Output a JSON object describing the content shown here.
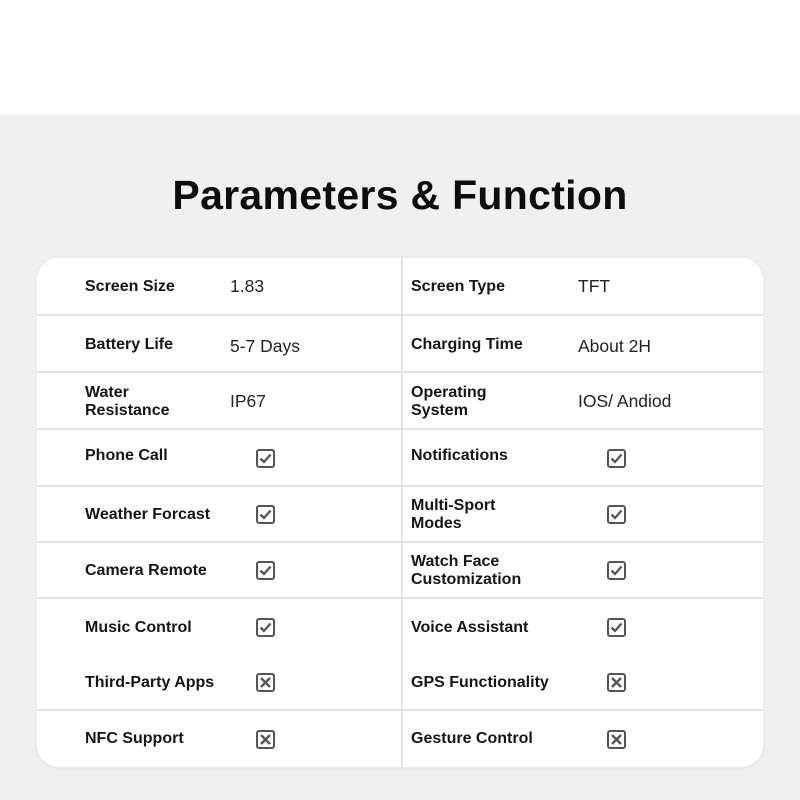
{
  "title": "Parameters & Function",
  "specs": [
    {
      "left": {
        "label": "Screen Size",
        "value": "1.83"
      },
      "right": {
        "label": "Screen Type",
        "value": "TFT"
      }
    },
    {
      "left": {
        "label": "Battery Life",
        "value": "5-7 Days"
      },
      "right": {
        "label": "Charging Time",
        "value": "About 2H"
      }
    },
    {
      "left": {
        "label": "Water Resistance",
        "value": "IP67"
      },
      "right": {
        "label": "Operating System",
        "value": "IOS/ Andiod"
      }
    }
  ],
  "features": [
    {
      "left": {
        "label": "Phone Call",
        "supported": true,
        "icon": "check-icon"
      },
      "right": {
        "label": "Notifications",
        "supported": true,
        "icon": "check-icon"
      }
    },
    {
      "left": {
        "label": "Weather Forcast",
        "supported": true,
        "icon": "check-icon"
      },
      "right": {
        "label": "Multi-Sport Modes",
        "supported": true,
        "icon": "check-icon"
      }
    },
    {
      "left": {
        "label": "Camera Remote",
        "supported": true,
        "icon": "check-icon"
      },
      "right": {
        "label": "Watch Face Customization",
        "supported": true,
        "icon": "check-icon"
      }
    },
    {
      "left": {
        "label": "Music Control",
        "supported": true,
        "icon": "check-icon"
      },
      "right": {
        "label": "Voice Assistant",
        "supported": true,
        "icon": "check-icon"
      }
    },
    {
      "left": {
        "label": "Third-Party Apps",
        "supported": false,
        "icon": "cross-icon"
      },
      "right": {
        "label": "GPS Functionality",
        "supported": false,
        "icon": "cross-icon"
      }
    },
    {
      "left": {
        "label": "NFC Support",
        "supported": false,
        "icon": "cross-icon"
      },
      "right": {
        "label": "Gesture Control",
        "supported": false,
        "icon": "cross-icon"
      }
    }
  ],
  "colors": {
    "background": "#f1f1f1",
    "card": "#ffffff",
    "divider": "#e3e3e3",
    "icon": "#555555",
    "text": "#111111"
  }
}
